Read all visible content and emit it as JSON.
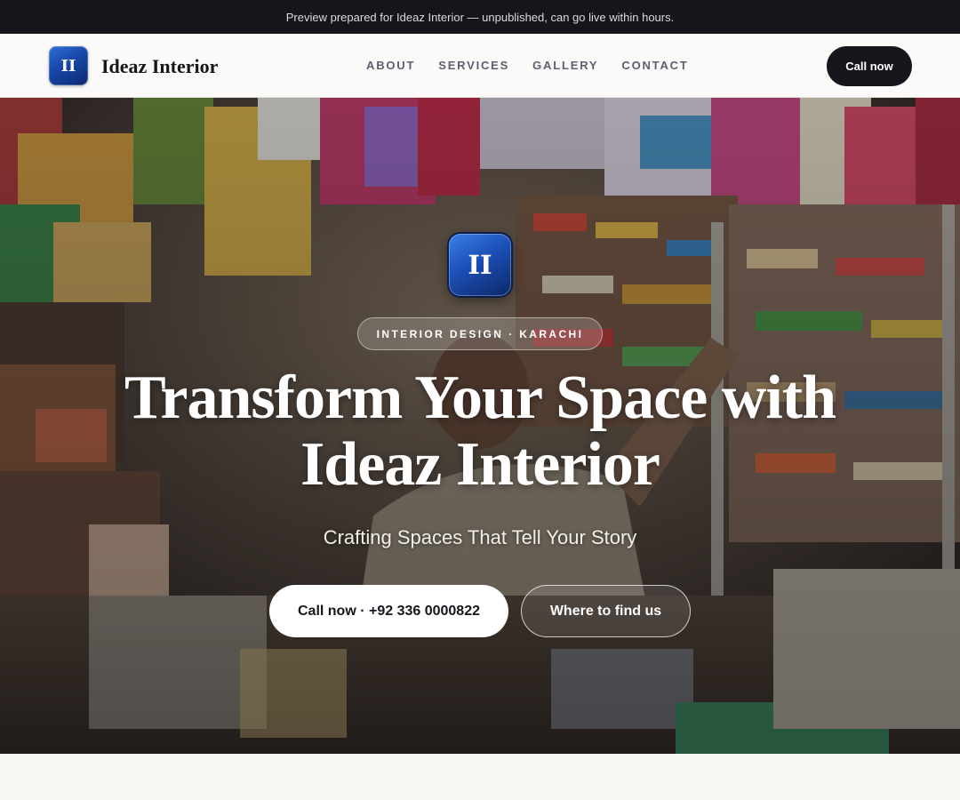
{
  "preview_banner": "Preview prepared for Ideaz Interior — unpublished, can go live within hours.",
  "header": {
    "logo_text": "II",
    "brand_name": "Ideaz Interior",
    "nav": [
      "ABOUT",
      "SERVICES",
      "GALLERY",
      "CONTACT"
    ],
    "cta_label": "Call now"
  },
  "hero": {
    "logo_text": "II",
    "tagline": "INTERIOR DESIGN · KARACHI",
    "title_line1": "Transform Your Space with",
    "title_line2": "Ideaz Interior",
    "subtitle": "Crafting Spaces That Tell Your Story",
    "primary_button": "Call now · +92 336 0000822",
    "secondary_button": "Where to find us",
    "background_image": "shopkeeper-in-crowded-general-store-photo"
  },
  "colors": {
    "dark": "#15171c",
    "logo_blue": "#1747a8",
    "page_bg": "#f8f7f4"
  }
}
